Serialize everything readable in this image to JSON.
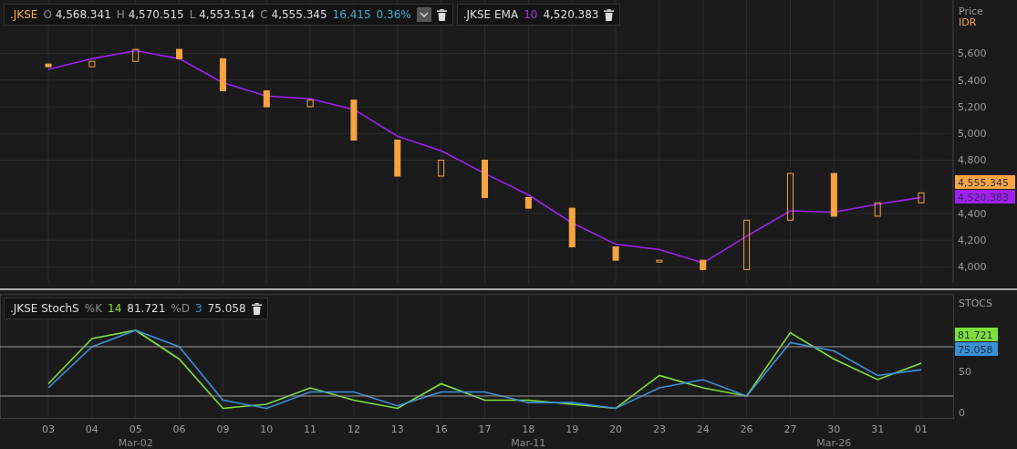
{
  "price_legend": {
    "symbol": ".JKSE",
    "fields": [
      {
        "label": "O",
        "value": "4,568.341"
      },
      {
        "label": "H",
        "value": "4,570.515"
      },
      {
        "label": "L",
        "value": "4,553.514"
      },
      {
        "label": "C",
        "value": "4,555.345"
      }
    ],
    "change": "16.415",
    "change_pct": "0.36%"
  },
  "ema_legend": {
    "period": "10",
    "value": "4,520.383"
  },
  "price_axis": {
    "title": "Price",
    "currency": "IDR"
  },
  "price_chart": {
    "chart_data": {
      "type": "line",
      "grid": true,
      "ylim": [
        3880,
        6000
      ],
      "yticks": [
        {
          "value": 4000,
          "label": "4,000"
        },
        {
          "value": 4200,
          "label": "4,200"
        },
        {
          "value": 4400,
          "label": "4,400"
        },
        {
          "value": 4800,
          "label": "4,800"
        },
        {
          "value": 5000,
          "label": "5,000"
        },
        {
          "value": 5200,
          "label": "5,200"
        },
        {
          "value": 5400,
          "label": "5,400"
        },
        {
          "value": 5600,
          "label": "5,600"
        }
      ],
      "series": [
        {
          "name": ".JKSE EMA",
          "color": "#a020f0",
          "values": [
            5480,
            5560,
            5620,
            5560,
            5380,
            5280,
            5260,
            5180,
            4980,
            4870,
            4700,
            4540,
            4330,
            4170,
            4130,
            4030,
            4230,
            4420,
            4410,
            4470,
            4520
          ]
        }
      ]
    },
    "badges": [
      {
        "text": "4,555.345",
        "color": "#f7a541"
      },
      {
        "text": "4,520.383",
        "color": "#a020f0"
      }
    ]
  },
  "stoch_legend": {
    "name": ".JKSE StochS",
    "k_period": "14",
    "k_value": "81.721",
    "d_period": "3",
    "d_value": "75.058"
  },
  "stoch_axis": {
    "title": "STOCS"
  },
  "stoch_chart": {
    "chart_data": {
      "type": "line",
      "grid": true,
      "categories": [
        "03",
        "04",
        "05",
        "06",
        "09",
        "10",
        "11",
        "12",
        "13",
        "16",
        "17",
        "18",
        "19",
        "20",
        "23",
        "24",
        "26",
        "27",
        "30",
        "31",
        "01"
      ],
      "ylim": [
        -6.7,
        144.4
      ],
      "yticks": [
        0,
        50
      ],
      "series": [
        {
          "name": "%K",
          "color": "#7ee03a",
          "values": [
            35,
            90,
            100,
            65,
            5,
            10,
            30,
            15,
            5,
            35,
            15,
            15,
            10,
            5,
            45,
            30,
            20,
            97,
            65,
            40,
            60
          ]
        },
        {
          "name": "%D",
          "color": "#3a8fd6",
          "values": [
            30,
            80,
            100,
            80,
            15,
            5,
            25,
            25,
            8,
            25,
            25,
            12,
            12,
            5,
            30,
            40,
            20,
            85,
            75,
            45,
            52
          ]
        }
      ]
    },
    "badges": [
      {
        "text": "81.721",
        "color": "#7ee03a"
      },
      {
        "text": "75.058",
        "color": "#3a8fd6"
      }
    ]
  },
  "months": [
    "Mar-02",
    "Mar-11",
    "Mar-26"
  ]
}
